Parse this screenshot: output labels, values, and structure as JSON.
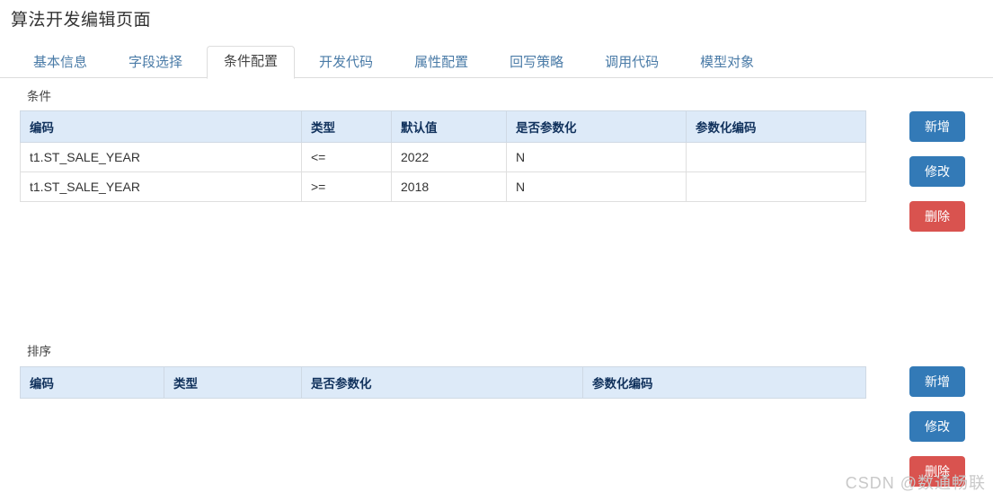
{
  "page": {
    "title": "算法开发编辑页面"
  },
  "tabs": [
    {
      "label": "基本信息",
      "active": false
    },
    {
      "label": "字段选择",
      "active": false
    },
    {
      "label": "条件配置",
      "active": true
    },
    {
      "label": "开发代码",
      "active": false
    },
    {
      "label": "属性配置",
      "active": false
    },
    {
      "label": "回写策略",
      "active": false
    },
    {
      "label": "调用代码",
      "active": false
    },
    {
      "label": "模型对象",
      "active": false
    }
  ],
  "condition_section": {
    "label": "条件",
    "columns": [
      "编码",
      "类型",
      "默认值",
      "是否参数化",
      "参数化编码"
    ],
    "rows": [
      {
        "code": "t1.ST_SALE_YEAR",
        "type": "<=",
        "default_value": "2022",
        "parameterized": "N",
        "param_code": ""
      },
      {
        "code": "t1.ST_SALE_YEAR",
        "type": ">=",
        "default_value": "2018",
        "parameterized": "N",
        "param_code": ""
      }
    ],
    "buttons": {
      "add": "新增",
      "edit": "修改",
      "delete": "删除"
    }
  },
  "order_section": {
    "label": "排序",
    "columns": [
      "编码",
      "类型",
      "是否参数化",
      "参数化编码"
    ],
    "rows": [],
    "buttons": {
      "add": "新增",
      "edit": "修改",
      "delete": "删除"
    }
  },
  "watermark": {
    "text": "CSDN @数通畅联"
  },
  "colors": {
    "primary": "#337ab7",
    "danger": "#d9534f",
    "table_header_bg": "#ddeaf8",
    "table_header_text": "#10315c",
    "tab_inactive_text": "#4a7ba7"
  }
}
